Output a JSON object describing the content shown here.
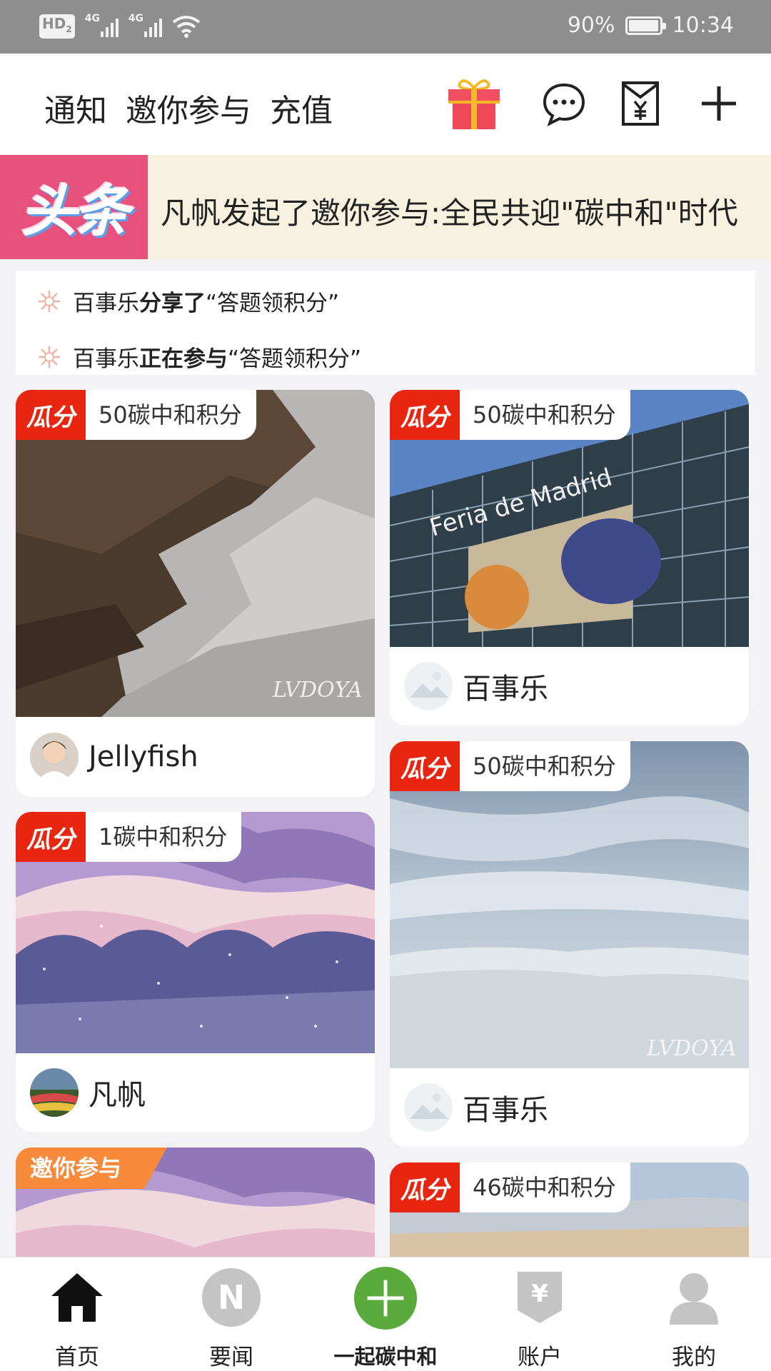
{
  "status_bar": {
    "hd": "HD",
    "hd_sub": "2",
    "net1": "4G",
    "net2": "4G",
    "battery": "90%",
    "time": "10:34",
    "battery_level": 0.9
  },
  "header": {
    "tabs": [
      "通知",
      "邀你参与",
      "充值"
    ],
    "icons": [
      "gift-icon",
      "chat-bubble-icon",
      "yuan-envelope-icon",
      "plus-icon"
    ]
  },
  "headline": {
    "badge": "头条",
    "text": "凡帆发起了邀你参与:全民共迎\"碳中和\"时代"
  },
  "activity": [
    {
      "user": "百事乐",
      "action": "分享了",
      "title": "“答题领积分”"
    },
    {
      "user": "百事乐",
      "action": "正在参与",
      "title": "“答题领积分”"
    }
  ],
  "cards": [
    {
      "tag": "瓜分",
      "reward": "50碳中和积分",
      "author": "Jellyfish",
      "watermark": "LVDOYA"
    },
    {
      "tag": "瓜分",
      "reward": "50碳中和积分",
      "author": "百事乐",
      "image_text": "Feria de Madrid"
    },
    {
      "tag": "瓜分",
      "reward": "1碳中和积分",
      "author": "凡帆"
    },
    {
      "tag": "瓜分",
      "reward": "50碳中和积分",
      "author": "百事乐",
      "watermark": "LVDOYA"
    },
    {
      "invite_tag": "邀你参与"
    },
    {
      "tag": "瓜分",
      "reward": "46碳中和积分"
    }
  ],
  "bottom_nav": [
    {
      "label": "首页",
      "icon": "home-icon"
    },
    {
      "label": "要闻",
      "icon": "news-n-icon",
      "glyph": "N"
    },
    {
      "label": "一起碳中和",
      "icon": "add-circle-icon"
    },
    {
      "label": "账户",
      "icon": "account-yuan-icon",
      "glyph": "¥"
    },
    {
      "label": "我的",
      "icon": "person-icon"
    }
  ],
  "colors": {
    "accent_red": "#e8250f",
    "headline_pink": "#e8507d",
    "invite_orange": "#f78a3b",
    "add_green": "#5bab3c"
  }
}
